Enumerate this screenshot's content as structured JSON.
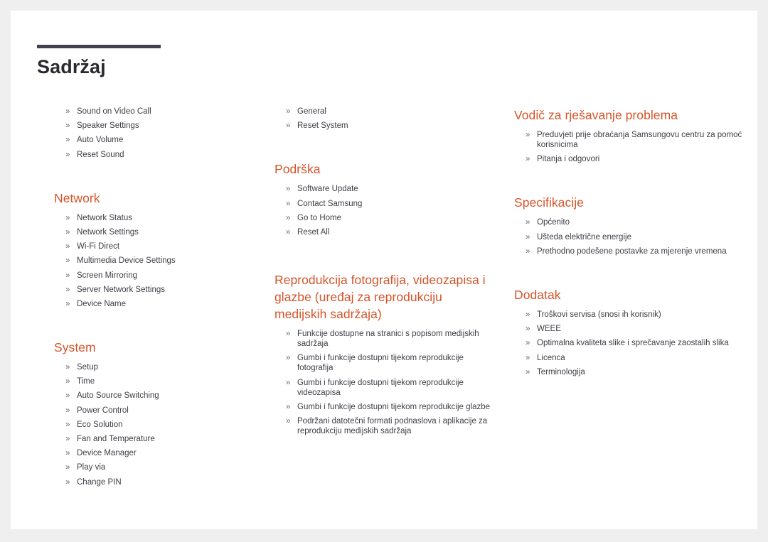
{
  "page": {
    "title": "Sadržaj",
    "bullet_glyph": "»",
    "accent_color": "#d6542a",
    "rule_color": "#41414e",
    "text_color": "#3e3e46",
    "page_background": "#ffffff",
    "canvas_background": "#efefef"
  },
  "columns": [
    {
      "id": "left",
      "sections": [
        {
          "heading": null,
          "items": [
            "Sound on Video Call",
            "Speaker Settings",
            "Auto Volume",
            "Reset Sound"
          ]
        },
        {
          "heading": "Network",
          "items": [
            "Network Status",
            "Network Settings",
            "Wi-Fi Direct",
            "Multimedia Device Settings",
            "Screen Mirroring",
            "Server Network Settings",
            "Device Name"
          ]
        },
        {
          "heading": "System",
          "items": [
            "Setup",
            "Time",
            "Auto Source Switching",
            "Power Control",
            "Eco Solution",
            "Fan and Temperature",
            "Device Manager",
            "Play via",
            "Change PIN"
          ]
        }
      ]
    },
    {
      "id": "middle",
      "sections": [
        {
          "heading": null,
          "items": [
            "General",
            "Reset System"
          ]
        },
        {
          "heading": "Podrška",
          "items": [
            "Software Update",
            "Contact Samsung",
            "Go to Home",
            "Reset All"
          ]
        },
        {
          "heading": "Reprodukcija fotografija, videozapisa i glazbe (uređaj za reprodukciju medijskih sadržaja)",
          "items": [
            "Funkcije dostupne na stranici s popisom medijskih sadržaja",
            "Gumbi i funkcije dostupni tijekom reprodukcije fotografija",
            "Gumbi i funkcije dostupni tijekom reprodukcije videozapisa",
            "Gumbi i funkcije dostupni tijekom reprodukcije glazbe",
            "Podržani datotečni formati podnaslova i aplikacije za reprodukciju medijskih sadržaja"
          ]
        }
      ]
    },
    {
      "id": "right",
      "sections": [
        {
          "heading": "Vodič za rješavanje problema",
          "items": [
            "Preduvjeti prije obraćanja Samsungovu centru za pomoć korisnicima",
            "Pitanja i odgovori"
          ]
        },
        {
          "heading": "Specifikacije",
          "items": [
            "Općenito",
            "Ušteda električne energije",
            "Prethodno podešene postavke za mjerenje vremena"
          ]
        },
        {
          "heading": "Dodatak",
          "items": [
            "Troškovi servisa (snosi ih korisnik)",
            "WEEE",
            "Optimalna kvaliteta slike i sprečavanje zaostalih slika",
            "Licenca",
            "Terminologija"
          ]
        }
      ]
    }
  ]
}
